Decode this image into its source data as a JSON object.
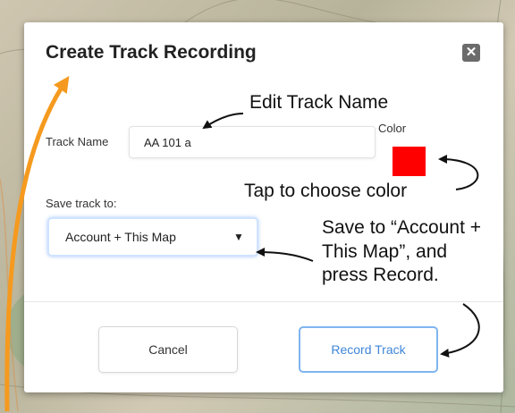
{
  "dialog": {
    "title": "Create Track Recording",
    "close_icon": "close-icon",
    "track_name_label": "Track Name",
    "track_name_value": "AA 101 a",
    "color_label": "Color",
    "color_value": "#ff0000",
    "save_label": "Save track to:",
    "save_selected": "Account + This Map",
    "cancel_label": "Cancel",
    "record_label": "Record Track"
  },
  "annotations": {
    "edit_name": "Edit Track Name",
    "tap_color": "Tap to choose color",
    "save_line1": "Save to “Account +",
    "save_line2": "This Map”, and",
    "save_line3": "press Record."
  },
  "colors": {
    "accent_blue": "#3f86d8",
    "arrow_orange": "#f59a1e",
    "swatch": "#ff0000"
  }
}
